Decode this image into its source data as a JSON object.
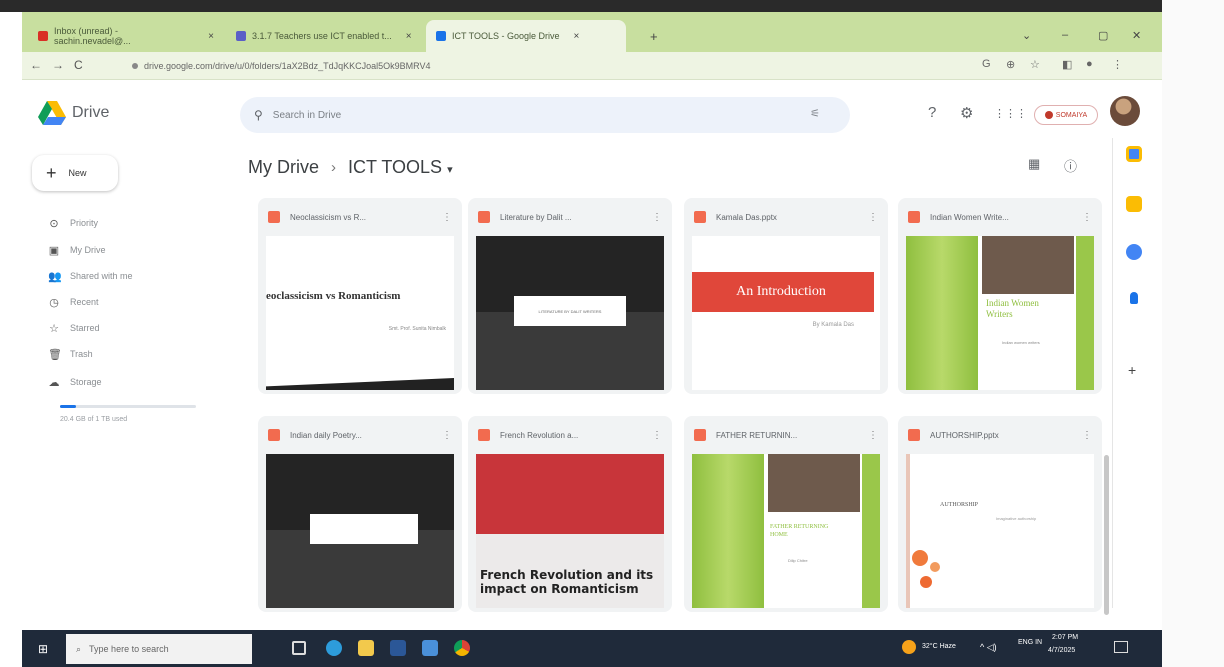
{
  "browser": {
    "tabs": [
      {
        "label": "Inbox (unread) - sachin.nevadel@...",
        "active": false,
        "fav_color": "#d93025"
      },
      {
        "label": "3.1.7 Teachers use ICT enabled t...",
        "active": false,
        "fav_color": "#5b5fc7"
      },
      {
        "label": "ICT TOOLS - Google Drive",
        "active": true,
        "fav_color": "#1a73e8"
      }
    ],
    "tab_close": "×",
    "new_tab": "+",
    "window_controls": [
      "⌄",
      "–",
      "▢",
      "✕"
    ],
    "nav": {
      "back": "←",
      "forward": "→",
      "reload": "C"
    },
    "url": "drive.google.com/drive/u/0/folders/1aX2Bdz_TdJqKKCJoal5Ok9BMRV4",
    "addr_icons": [
      "G",
      "⊕",
      "☆",
      "◧",
      "●",
      "⋮"
    ]
  },
  "drive": {
    "title": "Drive",
    "search_placeholder": "Search in Drive",
    "tune_icon": "⚟",
    "header_icons": [
      "?",
      "⚙",
      "⋮⋮⋮"
    ],
    "account_label": "SOMAIYA"
  },
  "sidebar": {
    "new_label": "New",
    "new_icon": "+",
    "items": [
      {
        "label": "Priority",
        "icon": "⊙",
        "name": "priority"
      },
      {
        "label": "My Drive",
        "icon": "▣",
        "name": "my-drive"
      },
      {
        "label": "Shared with me",
        "icon": "👥",
        "name": "shared"
      },
      {
        "label": "Recent",
        "icon": "◷",
        "name": "recent"
      },
      {
        "label": "Starred",
        "icon": "☆",
        "name": "starred"
      },
      {
        "label": "Trash",
        "icon": "🗑",
        "name": "trash"
      },
      {
        "label": "Storage",
        "icon": "☁",
        "name": "storage"
      }
    ],
    "storage_fraction": 0.12,
    "storage_text": "20.4 GB of 1 TB used"
  },
  "breadcrumb": {
    "root": "My Drive",
    "separator": "›",
    "current": "ICT TOOLS",
    "dropdown": "▾",
    "view_icons": [
      "▦",
      "ⓘ"
    ]
  },
  "files": [
    {
      "name": "Neoclassicism vs R...",
      "thumb_text": "eoclassicism vs Romanticism",
      "thumb_sub": "Smt. Prof. Sunita Nimbalk"
    },
    {
      "name": "Literature by Dalit ...",
      "thumb_text": "LITERATURE BY DALIT WRITERS",
      "thumb_sub": ""
    },
    {
      "name": "Kamala Das.pptx",
      "thumb_text": "An Introduction",
      "thumb_sub": "By Kamala Das"
    },
    {
      "name": "Indian Women Write...",
      "thumb_text": "Indian Women Writers",
      "thumb_sub": "Indian women writers"
    },
    {
      "name": "Indian daily Poetry...",
      "thumb_text": "",
      "thumb_sub": ""
    },
    {
      "name": "French Revolution a...",
      "thumb_text": "French Revolution and its impact on Romanticism",
      "thumb_sub": ""
    },
    {
      "name": "FATHER RETURNIN...",
      "thumb_text": "FATHER RETURNING HOME",
      "thumb_sub": "Dilip Chitre"
    },
    {
      "name": "AUTHORSHIP.pptx",
      "thumb_text": "AUTHORSHIP",
      "thumb_sub": "Imaginative authorship"
    }
  ],
  "kebab": "⋮",
  "taskbar": {
    "start": "⊞",
    "search_icon": "⌕",
    "search_placeholder": "Type here to search",
    "weather": "32°C Haze",
    "tray_arrows": "^ ◁)",
    "lang": "ENG IN",
    "time": "2:07 PM",
    "date": "4/7/2025"
  }
}
